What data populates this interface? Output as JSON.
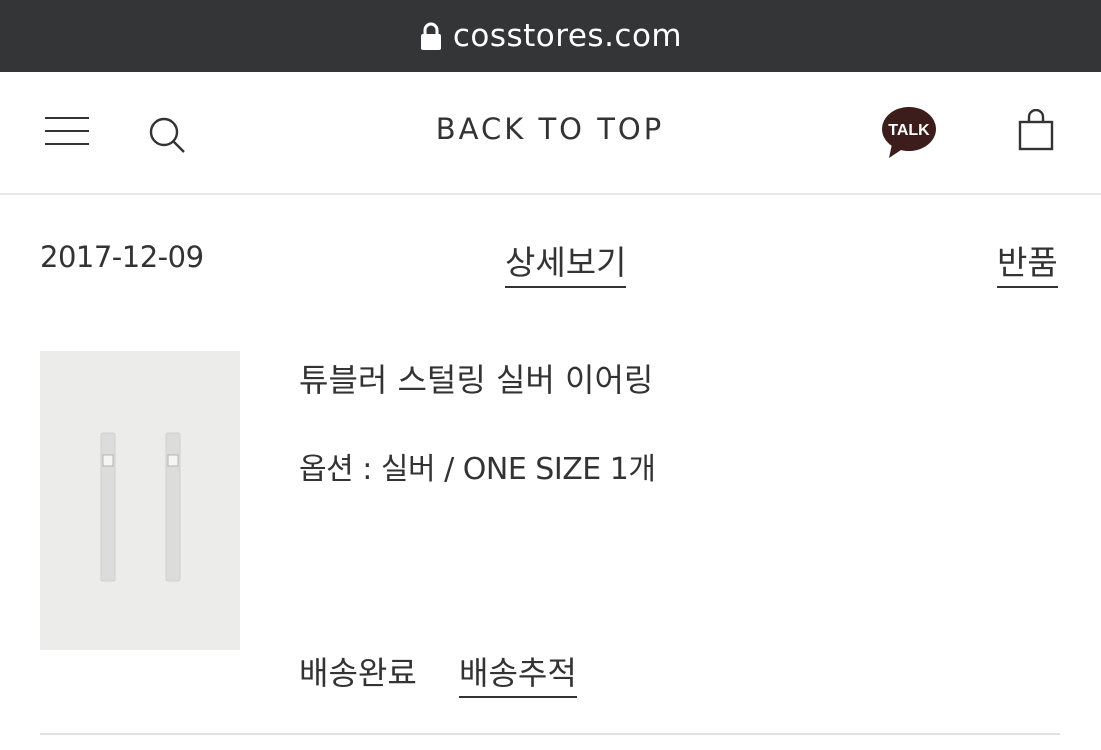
{
  "browser": {
    "url": "cosstores.com",
    "lock_icon": "lock-icon"
  },
  "header": {
    "menu_icon": "hamburger-icon",
    "search_icon": "search-icon",
    "back_to_top": "BACK TO TOP",
    "talk_badge": "TALK",
    "talk_color": "#3d1d1c",
    "bag_icon": "shopping-bag-icon"
  },
  "order": {
    "date": "2017-12-09",
    "detail_label": "상세보기",
    "return_label": "반품",
    "item": {
      "name": "튜블러 스털링 실버 이어링",
      "option": "옵션 : 실버 / ONE SIZE 1개",
      "status": "배송완료",
      "tracking_label": "배송추적"
    }
  }
}
